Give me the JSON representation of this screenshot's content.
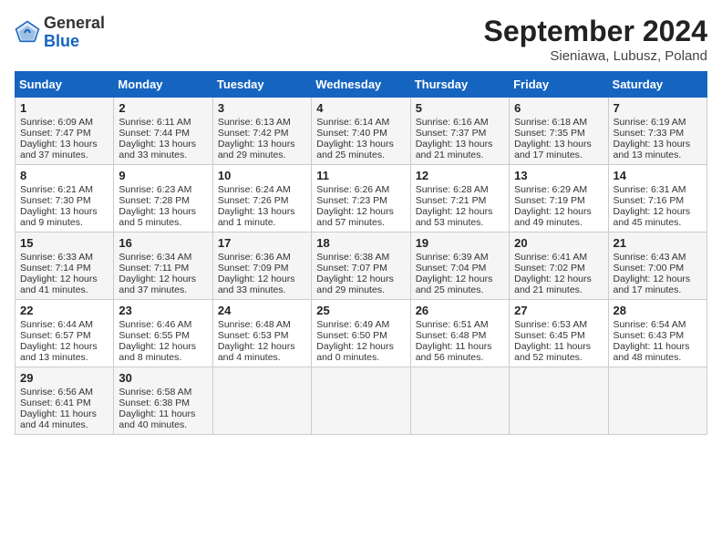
{
  "header": {
    "logo_line1": "General",
    "logo_line2": "Blue",
    "title": "September 2024",
    "subtitle": "Sieniawa, Lubusz, Poland"
  },
  "calendar": {
    "weekdays": [
      "Sunday",
      "Monday",
      "Tuesday",
      "Wednesday",
      "Thursday",
      "Friday",
      "Saturday"
    ],
    "rows": [
      [
        {
          "day": "1",
          "lines": [
            "Sunrise: 6:09 AM",
            "Sunset: 7:47 PM",
            "Daylight: 13 hours",
            "and 37 minutes."
          ]
        },
        {
          "day": "2",
          "lines": [
            "Sunrise: 6:11 AM",
            "Sunset: 7:44 PM",
            "Daylight: 13 hours",
            "and 33 minutes."
          ]
        },
        {
          "day": "3",
          "lines": [
            "Sunrise: 6:13 AM",
            "Sunset: 7:42 PM",
            "Daylight: 13 hours",
            "and 29 minutes."
          ]
        },
        {
          "day": "4",
          "lines": [
            "Sunrise: 6:14 AM",
            "Sunset: 7:40 PM",
            "Daylight: 13 hours",
            "and 25 minutes."
          ]
        },
        {
          "day": "5",
          "lines": [
            "Sunrise: 6:16 AM",
            "Sunset: 7:37 PM",
            "Daylight: 13 hours",
            "and 21 minutes."
          ]
        },
        {
          "day": "6",
          "lines": [
            "Sunrise: 6:18 AM",
            "Sunset: 7:35 PM",
            "Daylight: 13 hours",
            "and 17 minutes."
          ]
        },
        {
          "day": "7",
          "lines": [
            "Sunrise: 6:19 AM",
            "Sunset: 7:33 PM",
            "Daylight: 13 hours",
            "and 13 minutes."
          ]
        }
      ],
      [
        {
          "day": "8",
          "lines": [
            "Sunrise: 6:21 AM",
            "Sunset: 7:30 PM",
            "Daylight: 13 hours",
            "and 9 minutes."
          ]
        },
        {
          "day": "9",
          "lines": [
            "Sunrise: 6:23 AM",
            "Sunset: 7:28 PM",
            "Daylight: 13 hours",
            "and 5 minutes."
          ]
        },
        {
          "day": "10",
          "lines": [
            "Sunrise: 6:24 AM",
            "Sunset: 7:26 PM",
            "Daylight: 13 hours",
            "and 1 minute."
          ]
        },
        {
          "day": "11",
          "lines": [
            "Sunrise: 6:26 AM",
            "Sunset: 7:23 PM",
            "Daylight: 12 hours",
            "and 57 minutes."
          ]
        },
        {
          "day": "12",
          "lines": [
            "Sunrise: 6:28 AM",
            "Sunset: 7:21 PM",
            "Daylight: 12 hours",
            "and 53 minutes."
          ]
        },
        {
          "day": "13",
          "lines": [
            "Sunrise: 6:29 AM",
            "Sunset: 7:19 PM",
            "Daylight: 12 hours",
            "and 49 minutes."
          ]
        },
        {
          "day": "14",
          "lines": [
            "Sunrise: 6:31 AM",
            "Sunset: 7:16 PM",
            "Daylight: 12 hours",
            "and 45 minutes."
          ]
        }
      ],
      [
        {
          "day": "15",
          "lines": [
            "Sunrise: 6:33 AM",
            "Sunset: 7:14 PM",
            "Daylight: 12 hours",
            "and 41 minutes."
          ]
        },
        {
          "day": "16",
          "lines": [
            "Sunrise: 6:34 AM",
            "Sunset: 7:11 PM",
            "Daylight: 12 hours",
            "and 37 minutes."
          ]
        },
        {
          "day": "17",
          "lines": [
            "Sunrise: 6:36 AM",
            "Sunset: 7:09 PM",
            "Daylight: 12 hours",
            "and 33 minutes."
          ]
        },
        {
          "day": "18",
          "lines": [
            "Sunrise: 6:38 AM",
            "Sunset: 7:07 PM",
            "Daylight: 12 hours",
            "and 29 minutes."
          ]
        },
        {
          "day": "19",
          "lines": [
            "Sunrise: 6:39 AM",
            "Sunset: 7:04 PM",
            "Daylight: 12 hours",
            "and 25 minutes."
          ]
        },
        {
          "day": "20",
          "lines": [
            "Sunrise: 6:41 AM",
            "Sunset: 7:02 PM",
            "Daylight: 12 hours",
            "and 21 minutes."
          ]
        },
        {
          "day": "21",
          "lines": [
            "Sunrise: 6:43 AM",
            "Sunset: 7:00 PM",
            "Daylight: 12 hours",
            "and 17 minutes."
          ]
        }
      ],
      [
        {
          "day": "22",
          "lines": [
            "Sunrise: 6:44 AM",
            "Sunset: 6:57 PM",
            "Daylight: 12 hours",
            "and 13 minutes."
          ]
        },
        {
          "day": "23",
          "lines": [
            "Sunrise: 6:46 AM",
            "Sunset: 6:55 PM",
            "Daylight: 12 hours",
            "and 8 minutes."
          ]
        },
        {
          "day": "24",
          "lines": [
            "Sunrise: 6:48 AM",
            "Sunset: 6:53 PM",
            "Daylight: 12 hours",
            "and 4 minutes."
          ]
        },
        {
          "day": "25",
          "lines": [
            "Sunrise: 6:49 AM",
            "Sunset: 6:50 PM",
            "Daylight: 12 hours",
            "and 0 minutes."
          ]
        },
        {
          "day": "26",
          "lines": [
            "Sunrise: 6:51 AM",
            "Sunset: 6:48 PM",
            "Daylight: 11 hours",
            "and 56 minutes."
          ]
        },
        {
          "day": "27",
          "lines": [
            "Sunrise: 6:53 AM",
            "Sunset: 6:45 PM",
            "Daylight: 11 hours",
            "and 52 minutes."
          ]
        },
        {
          "day": "28",
          "lines": [
            "Sunrise: 6:54 AM",
            "Sunset: 6:43 PM",
            "Daylight: 11 hours",
            "and 48 minutes."
          ]
        }
      ],
      [
        {
          "day": "29",
          "lines": [
            "Sunrise: 6:56 AM",
            "Sunset: 6:41 PM",
            "Daylight: 11 hours",
            "and 44 minutes."
          ]
        },
        {
          "day": "30",
          "lines": [
            "Sunrise: 6:58 AM",
            "Sunset: 6:38 PM",
            "Daylight: 11 hours",
            "and 40 minutes."
          ]
        },
        {
          "day": "",
          "lines": []
        },
        {
          "day": "",
          "lines": []
        },
        {
          "day": "",
          "lines": []
        },
        {
          "day": "",
          "lines": []
        },
        {
          "day": "",
          "lines": []
        }
      ]
    ]
  }
}
